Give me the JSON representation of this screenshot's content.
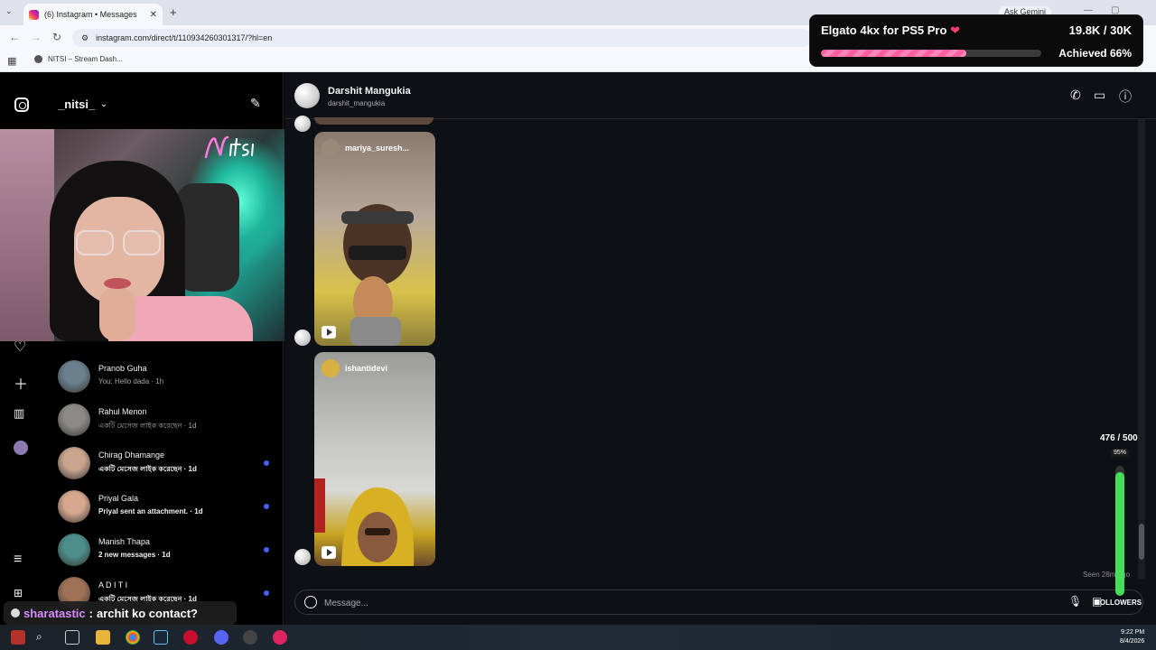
{
  "browser": {
    "tab_title": "(6) Instagram • Messages",
    "new_tab": "+",
    "ask_gemini": "Ask Gemini",
    "url": "instagram.com/direct/t/110934260301317/?hl=en",
    "bookmark": "NITSI – Stream Dash..."
  },
  "goal": {
    "title": "Elgato 4kx for PS5 Pro",
    "count": "19.8K / 30K",
    "achieved": "Achieved 66%",
    "progress": 0.66
  },
  "inbox": {
    "username": "_nitsi_",
    "contacts": [
      {
        "name": "Pranob Guha",
        "preview": "You: Hello dada · 1h",
        "bold": false,
        "unread": false,
        "color": "#6b7f8c"
      },
      {
        "name": "Rahul Menon",
        "preview": "একটি মেসেজ লাইক করেছেন · 1d",
        "bold": false,
        "unread": false,
        "color": "#8d8a86"
      },
      {
        "name": "Chirag Dhamange",
        "preview": "একটি মেসেজ লাইক করেছেন · 1d",
        "bold": true,
        "unread": true,
        "color": "#c9a58e"
      },
      {
        "name": "Priyal Gala",
        "preview": "Priyal sent an attachment. · 1d",
        "bold": true,
        "unread": true,
        "color": "#d6a78e"
      },
      {
        "name": "Manish Thapa",
        "preview": "2 new messages · 1d",
        "bold": true,
        "unread": true,
        "color": "#4d8d8a"
      },
      {
        "name": "A D I T I",
        "preview": "একটি মেসেজ লাইক করেছেন · 1d",
        "bold": true,
        "unread": true,
        "color": "#a07255"
      }
    ]
  },
  "chat": {
    "name": "Darshit Mangukia",
    "username": "darshit_mangukia",
    "reels": [
      {
        "user": "mariya_suresh...",
        "bg": "linear-gradient(180deg,#8a7a6e 0%,#b9a89a 40%,#d8c24a 75%,#8d7e3a 100%)"
      },
      {
        "user": "ishantidevi",
        "bg": "linear-gradient(180deg,#9c9c98 0%,#c9c9c6 45%,#d8d8d4 65%,#c8a522 85%,#6a4a2a 100%)"
      }
    ],
    "seen": "Seen 28m ago",
    "placeholder": "Message..."
  },
  "followers": {
    "count": "476 / 500",
    "percent": "95%",
    "progress": 0.952,
    "label": "FOLLOWERS"
  },
  "stream_chat": {
    "user": "sharatastic",
    "separator": ":",
    "message": "archit ko contact?"
  },
  "taskbar": {
    "time": "9:22 PM",
    "date": "8/4/2026"
  },
  "colors": {
    "goal_fill": "#ff5fa0",
    "followers_fill": "#42e05a",
    "unread_dot": "#4a5df9"
  }
}
